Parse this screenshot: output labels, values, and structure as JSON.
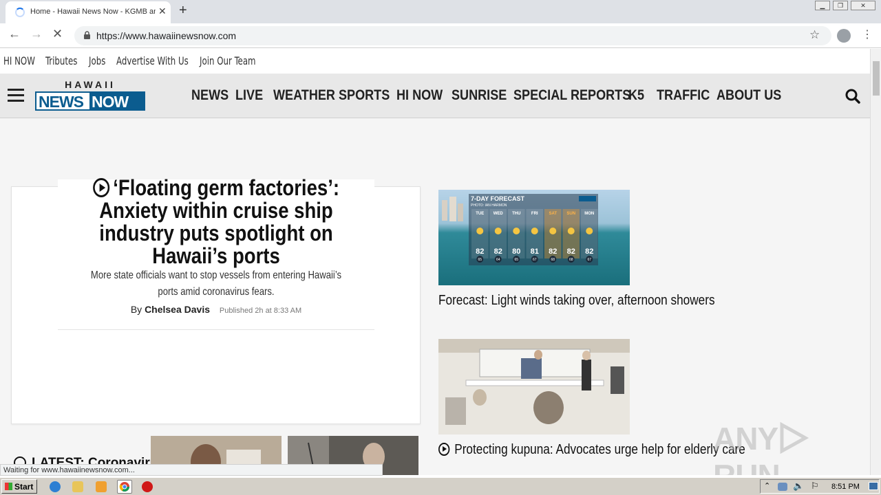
{
  "browser": {
    "tab_title": "Home - Hawaii News Now - KGMB and KHNL",
    "url": "https://www.hawaiinewsnow.com",
    "status": "Waiting for www.hawaiinewsnow.com..."
  },
  "utility_nav": [
    "HI NOW",
    "Tributes",
    "Jobs",
    "Advertise With Us",
    "Join Our Team"
  ],
  "logo": {
    "top": "HAWAII",
    "news": "NEWS",
    "now": "NOW"
  },
  "main_nav": [
    "NEWS",
    "LIVE",
    "WEATHER",
    "SPORTS",
    "HI NOW",
    "SUNRISE",
    "SPECIAL REPORTS",
    "K5",
    "TRAFFIC",
    "ABOUT US"
  ],
  "hero": {
    "title": "‘Floating germ factories’: Anxiety within cruise ship industry puts spotlight on Hawaii’s ports",
    "subtitle": "More state officials want to stop vessels from entering Hawaii’s ports amid coronavirus fears.",
    "by": "By",
    "author": "Chelsea Davis",
    "published": "Published 2h at 8:33 AM"
  },
  "latest_label": "LATEST: Coronavirus",
  "stories": [
    {
      "title": "Forecast: Light winds taking over, afternoon showers",
      "forecast": {
        "heading": "7-DAY FORECAST",
        "photo_credit": "PHOTO: IAN HARMON",
        "days": [
          "TUE",
          "WED",
          "THU",
          "FRI",
          "SAT",
          "SUN",
          "MON"
        ],
        "highs": [
          "82",
          "82",
          "80",
          "81",
          "82",
          "82",
          "82"
        ],
        "lows": [
          "65",
          "64",
          "65",
          "67",
          "68",
          "68",
          "67"
        ]
      }
    },
    {
      "title": "Protecting kupuna: Advocates urge help for elderly care"
    }
  ],
  "watermark": "ANY RUN",
  "taskbar": {
    "start": "Start",
    "clock": "8:51 PM"
  },
  "colors": {
    "brand_blue": "#0b5c8f",
    "nav_bg": "#e8e8e8"
  }
}
